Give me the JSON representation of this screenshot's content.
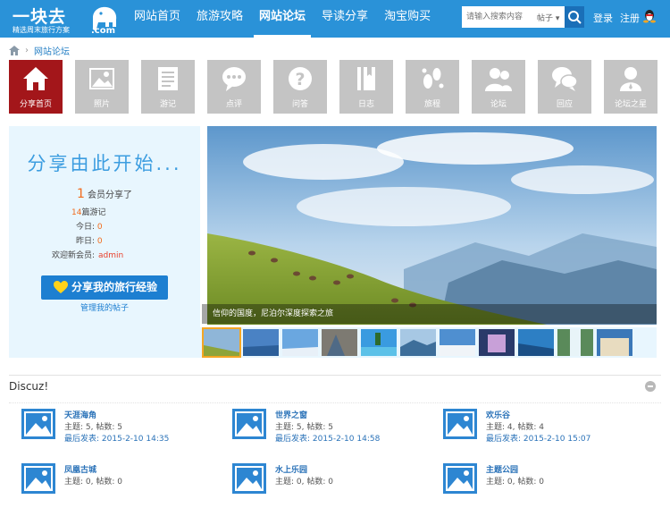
{
  "header": {
    "logo_main": "一块去",
    "logo_sub": "精选周末旅行方案",
    "logo_com": ".com",
    "nav": [
      {
        "label": "网站首页"
      },
      {
        "label": "旅游攻略"
      },
      {
        "label": "网站论坛"
      },
      {
        "label": "导读分享"
      },
      {
        "label": "淘宝购买"
      }
    ],
    "search_placeholder": "请输入搜索内容",
    "search_type": "帖子",
    "login": "登录",
    "register": "注册"
  },
  "breadcrumb": {
    "current": "网站论坛"
  },
  "tiles": [
    {
      "label": "分享首页",
      "icon": "home-icon"
    },
    {
      "label": "照片",
      "icon": "photo-icon"
    },
    {
      "label": "游记",
      "icon": "travelnote-icon"
    },
    {
      "label": "点评",
      "icon": "comment-icon"
    },
    {
      "label": "问答",
      "icon": "question-icon"
    },
    {
      "label": "日志",
      "icon": "diary-icon"
    },
    {
      "label": "旅程",
      "icon": "footprint-icon"
    },
    {
      "label": "论坛",
      "icon": "forum-users-icon"
    },
    {
      "label": "回应",
      "icon": "reply-icon"
    },
    {
      "label": "论坛之星",
      "icon": "star-user-icon"
    }
  ],
  "share": {
    "title": "分享由此开始...",
    "member_count": "1",
    "member_text": "会员分享了",
    "notes_count": "14",
    "notes_text": "篇游记",
    "today_label": "今日:",
    "today_value": "0",
    "yesterday_label": "昨日:",
    "yesterday_value": "0",
    "welcome_label": "欢迎新会员:",
    "welcome_user": "admin",
    "button": "分享我的旅行经验",
    "manage": "管理我的帖子"
  },
  "hero": {
    "caption": "信仰的国度，尼泊尔深度探索之旅"
  },
  "forum_section": {
    "title": "Discuz!",
    "forums": [
      {
        "name": "天涯海角",
        "stats": "主题: 5, 帖数: 5",
        "last_label": "最后发表:",
        "last_time": "2015-2-10 14:35"
      },
      {
        "name": "世界之窗",
        "stats": "主题: 5, 帖数: 5",
        "last_label": "最后发表:",
        "last_time": "2015-2-10 14:58"
      },
      {
        "name": "欢乐谷",
        "stats": "主题: 4, 帖数: 4",
        "last_label": "最后发表:",
        "last_time": "2015-2-10 15:07"
      },
      {
        "name": "凤凰古城",
        "stats": "主题: 0, 帖数: 0"
      },
      {
        "name": "水上乐园",
        "stats": "主题: 0, 帖数: 0"
      },
      {
        "name": "主题公园",
        "stats": "主题: 0, 帖数: 0"
      }
    ]
  },
  "colors": {
    "header": "#2a92d8",
    "active_tile": "#a3161a",
    "tile": "#c4c4c4",
    "accent": "#f26b1d"
  }
}
